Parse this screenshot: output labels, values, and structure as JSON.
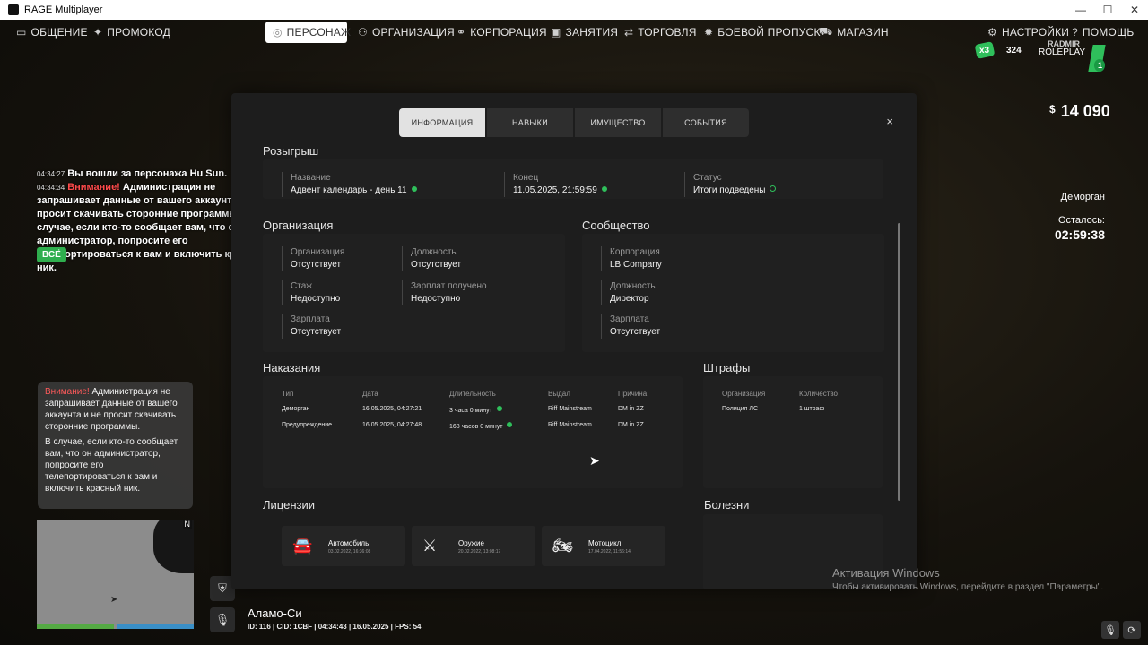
{
  "window": {
    "title": "RAGE Multiplayer",
    "controls": [
      "—",
      "☐",
      "✕"
    ]
  },
  "nav": {
    "left": [
      {
        "label": "ОБЩЕНИЕ",
        "icon": "chat-icon"
      },
      {
        "label": "ПРОМОКОД",
        "icon": "gift-icon"
      }
    ],
    "center": [
      {
        "label": "ПЕРСОНАЖ",
        "icon": "user-icon"
      },
      {
        "label": "ОРГАНИЗАЦИЯ",
        "icon": "group-icon"
      },
      {
        "label": "КОРПОРАЦИЯ",
        "icon": "handshake-icon"
      },
      {
        "label": "ЗАНЯТИЯ",
        "icon": "briefcase-icon"
      },
      {
        "label": "ТОРГОВЛЯ",
        "icon": "trade-icon"
      },
      {
        "label": "БОЕВОЙ ПРОПУСК",
        "icon": "badge-icon"
      },
      {
        "label": "МАГАЗИН",
        "icon": "cart-icon"
      }
    ],
    "right": [
      {
        "label": "НАСТРОЙКИ",
        "icon": "gear-icon"
      },
      {
        "label": "ПОМОЩЬ",
        "icon": "help-icon"
      }
    ]
  },
  "logo": {
    "x3": "x3",
    "num": "324",
    "l1": "RADMIR",
    "l2": "ROLEPLAY",
    "badge": "1"
  },
  "hud": {
    "currency": "$",
    "money": "14 090",
    "jail_label": "Деморган",
    "remaining_label": "Осталось:",
    "remaining": "02:59:38"
  },
  "chat": {
    "lines": [
      {
        "ts": "04:34:27",
        "text": "Вы вошли за персонажа Hu Sun."
      },
      {
        "ts": "04:34:34",
        "warn": "Внимание!",
        "text": "Администрация не запрашивает данные от вашего аккаунта и не просит скачивать сторонние программы. В случае, если кто-то сообщает вам, что он администратор, попросите его телепортироваться к вам и включить красный ник."
      }
    ],
    "all_button": "ВСЁ"
  },
  "notice": {
    "warn": "Внимание!",
    "p1": "Администрация не запрашивает данные от вашего аккаунта и не просит скачивать сторонние программы.",
    "p2": "В случае, если кто-то сообщает вам, что он администратор, попросите его телепортироваться к вам и включить красный ник."
  },
  "map": {
    "north": "N"
  },
  "location": {
    "name": "Аламо-Си",
    "stats": "ID: 116 | CID: 1CBF | 04:34:43 | 16.05.2025 | FPS: 54"
  },
  "windows_activation": {
    "title": "Активация Windows",
    "text": "Чтобы активировать Windows, перейдите в раздел \"Параметры\"."
  },
  "panel": {
    "tabs": [
      "ИНФОРМАЦИЯ",
      "НАВЫКИ",
      "ИМУЩЕСТВО",
      "СОБЫТИЯ"
    ],
    "close": "×",
    "raffle": {
      "title": "Розыгрыш",
      "name_label": "Название",
      "name": "Адвент календарь - день 11",
      "end_label": "Конец",
      "end": "11.05.2025, 21:59:59",
      "status_label": "Статус",
      "status": "Итоги подведены"
    },
    "org": {
      "title": "Организация",
      "org_label": "Организация",
      "org": "Отсутствует",
      "pos_label": "Должность",
      "pos": "Отсутствует",
      "exp_label": "Стаж",
      "exp": "Недоступно",
      "salary_got_label": "Зарплат получено",
      "salary_got": "Недоступно",
      "salary_label": "Зарплата",
      "salary": "Отсутствует"
    },
    "community": {
      "title": "Сообщество",
      "corp_label": "Корпорация",
      "corp": "LB Company",
      "pos_label": "Должность",
      "pos": "Директор",
      "salary_label": "Зарплата",
      "salary": "Отсутствует"
    },
    "punish": {
      "title": "Наказания",
      "headers": [
        "Тип",
        "Дата",
        "Длительность",
        "Выдал",
        "Причина"
      ],
      "rows": [
        [
          "Деморган",
          "16.05.2025, 04:27:21",
          "3 часа 0 минут",
          "Riff Mainstream",
          "DM in ZZ"
        ],
        [
          "Предупреждение",
          "16.05.2025, 04:27:48",
          "168 часов 0 минут",
          "Riff Mainstream",
          "DM in ZZ"
        ]
      ]
    },
    "fines": {
      "title": "Штрафы",
      "headers": [
        "Организация",
        "Количество"
      ],
      "rows": [
        [
          "Полиция ЛС",
          "1 штраф"
        ]
      ]
    },
    "licenses": {
      "title": "Лицензии",
      "items": [
        {
          "name": "Автомобиль",
          "date": "03.02.2022, 16:36:08",
          "icon": "car-icon"
        },
        {
          "name": "Оружие",
          "date": "20.02.2022, 13:08:17",
          "icon": "rifle-icon"
        },
        {
          "name": "Мотоцикл",
          "date": "17.04.2022, 11:56:14",
          "icon": "motorcycle-icon"
        }
      ]
    },
    "diseases": {
      "title": "Болезни"
    }
  }
}
